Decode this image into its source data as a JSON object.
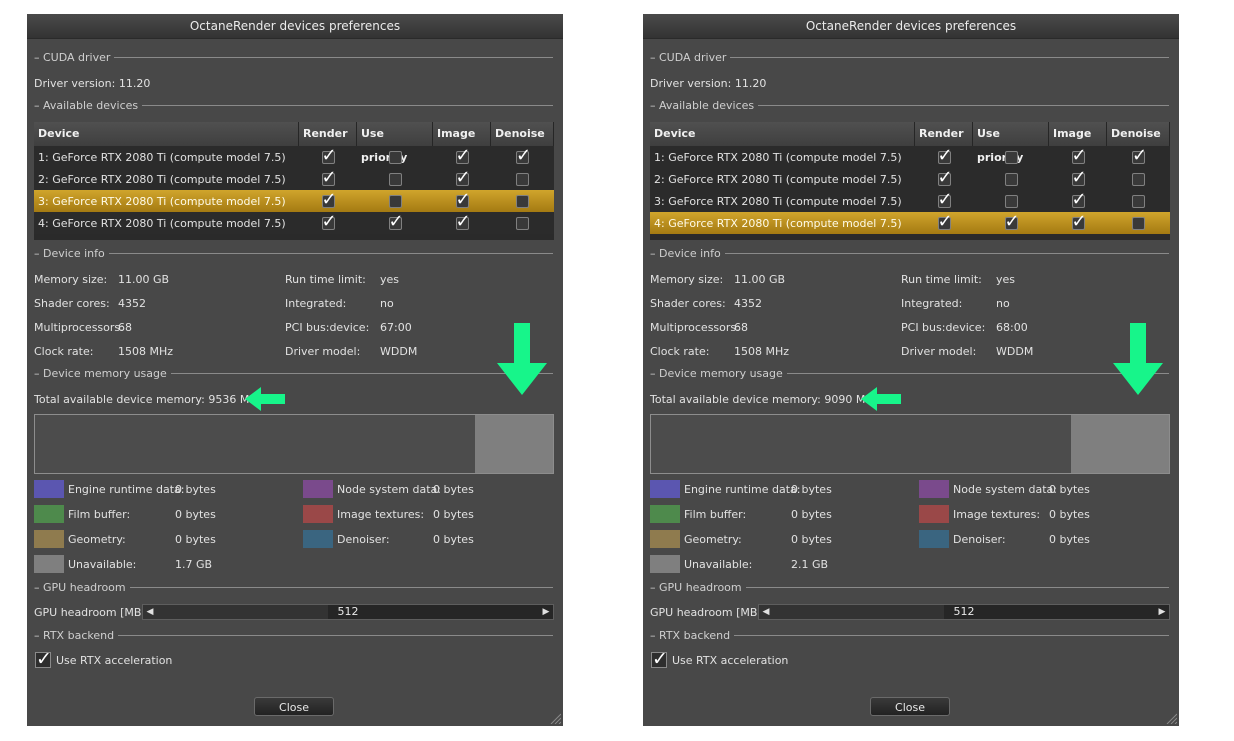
{
  "colors": {
    "arrow": "#17f58a",
    "engine_runtime": "#5b56b0",
    "film_buffer": "#4e8a4c",
    "geometry": "#8f7b4e",
    "unavailable": "#7f7f7f",
    "node_system": "#7a4a8c",
    "image_textures": "#9a4848",
    "denoiser": "#3a6580",
    "selected_row": "#c9a127"
  },
  "table_headers": [
    "Device",
    "Render",
    "Use priority",
    "Image",
    "Denoise"
  ],
  "dialogs": [
    {
      "title": "OctaneRender devices preferences",
      "cuda_section": "CUDA driver",
      "driver_version": "Driver version:  11.20",
      "devices_section": "Available devices",
      "devices": [
        {
          "name": "1: GeForce RTX 2080 Ti (compute model 7.5)",
          "render": true,
          "priority": false,
          "image": true,
          "denoise": true,
          "selected": false
        },
        {
          "name": "2: GeForce RTX 2080 Ti (compute model 7.5)",
          "render": true,
          "priority": false,
          "image": true,
          "denoise": false,
          "selected": false
        },
        {
          "name": "3: GeForce RTX 2080 Ti (compute model 7.5)",
          "render": true,
          "priority": false,
          "image": true,
          "denoise": false,
          "selected": true
        },
        {
          "name": "4: GeForce RTX 2080 Ti (compute model 7.5)",
          "render": true,
          "priority": true,
          "image": true,
          "denoise": false,
          "selected": false
        }
      ],
      "info_section": "Device info",
      "info_left": [
        {
          "label": "Memory size:",
          "value": "11.00 GB"
        },
        {
          "label": "Shader cores:",
          "value": "4352"
        },
        {
          "label": "Multiprocessors:",
          "value": "68"
        },
        {
          "label": "Clock rate:",
          "value": "1508 MHz"
        }
      ],
      "info_right": [
        {
          "label": "Run time limit:",
          "value": "yes"
        },
        {
          "label": "Integrated:",
          "value": "no"
        },
        {
          "label": "PCI bus:device:",
          "value": "67:00"
        },
        {
          "label": "Driver model:",
          "value": "WDDM"
        }
      ],
      "memory_section": "Device memory usage",
      "total_memory": "Total available device memory:  9536 MB",
      "unavailable_fraction": 0.15,
      "legend_left": [
        {
          "label": "Engine runtime data:",
          "value": "0 bytes",
          "color": "#5b56b0"
        },
        {
          "label": "Film buffer:",
          "value": "0 bytes",
          "color": "#4e8a4c"
        },
        {
          "label": "Geometry:",
          "value": "0 bytes",
          "color": "#8f7b4e"
        },
        {
          "label": "Unavailable:",
          "value": "1.7 GB",
          "color": "#7f7f7f"
        }
      ],
      "legend_right": [
        {
          "label": "Node system data:",
          "value": "0 bytes",
          "color": "#7a4a8c"
        },
        {
          "label": "Image textures:",
          "value": "0 bytes",
          "color": "#9a4848"
        },
        {
          "label": "Denoiser:",
          "value": "0 bytes",
          "color": "#3a6580"
        }
      ],
      "headroom_section": "GPU headroom",
      "headroom_label": "GPU headroom [MB]:",
      "headroom_value": "512",
      "headroom_fraction": 0.45,
      "rtx_section": "RTX backend",
      "rtx_label": "Use RTX acceleration",
      "rtx_checked": true,
      "close_label": "Close"
    },
    {
      "title": "OctaneRender devices preferences",
      "cuda_section": "CUDA driver",
      "driver_version": "Driver version:  11.20",
      "devices_section": "Available devices",
      "devices": [
        {
          "name": "1: GeForce RTX 2080 Ti (compute model 7.5)",
          "render": true,
          "priority": false,
          "image": true,
          "denoise": true,
          "selected": false
        },
        {
          "name": "2: GeForce RTX 2080 Ti (compute model 7.5)",
          "render": true,
          "priority": false,
          "image": true,
          "denoise": false,
          "selected": false
        },
        {
          "name": "3: GeForce RTX 2080 Ti (compute model 7.5)",
          "render": true,
          "priority": false,
          "image": true,
          "denoise": false,
          "selected": false
        },
        {
          "name": "4: GeForce RTX 2080 Ti (compute model 7.5)",
          "render": true,
          "priority": true,
          "image": true,
          "denoise": false,
          "selected": true
        }
      ],
      "info_section": "Device info",
      "info_left": [
        {
          "label": "Memory size:",
          "value": "11.00 GB"
        },
        {
          "label": "Shader cores:",
          "value": "4352"
        },
        {
          "label": "Multiprocessors:",
          "value": "68"
        },
        {
          "label": "Clock rate:",
          "value": "1508 MHz"
        }
      ],
      "info_right": [
        {
          "label": "Run time limit:",
          "value": "yes"
        },
        {
          "label": "Integrated:",
          "value": "no"
        },
        {
          "label": "PCI bus:device:",
          "value": "68:00"
        },
        {
          "label": "Driver model:",
          "value": "WDDM"
        }
      ],
      "memory_section": "Device memory usage",
      "total_memory": "Total available device memory:  9090 MB",
      "unavailable_fraction": 0.19,
      "legend_left": [
        {
          "label": "Engine runtime data:",
          "value": "0 bytes",
          "color": "#5b56b0"
        },
        {
          "label": "Film buffer:",
          "value": "0 bytes",
          "color": "#4e8a4c"
        },
        {
          "label": "Geometry:",
          "value": "0 bytes",
          "color": "#8f7b4e"
        },
        {
          "label": "Unavailable:",
          "value": "2.1 GB",
          "color": "#7f7f7f"
        }
      ],
      "legend_right": [
        {
          "label": "Node system data:",
          "value": "0 bytes",
          "color": "#7a4a8c"
        },
        {
          "label": "Image textures:",
          "value": "0 bytes",
          "color": "#9a4848"
        },
        {
          "label": "Denoiser:",
          "value": "0 bytes",
          "color": "#3a6580"
        }
      ],
      "headroom_section": "GPU headroom",
      "headroom_label": "GPU headroom [MB]:",
      "headroom_value": "512",
      "headroom_fraction": 0.45,
      "rtx_section": "RTX backend",
      "rtx_label": "Use RTX acceleration",
      "rtx_checked": true,
      "close_label": "Close"
    }
  ]
}
